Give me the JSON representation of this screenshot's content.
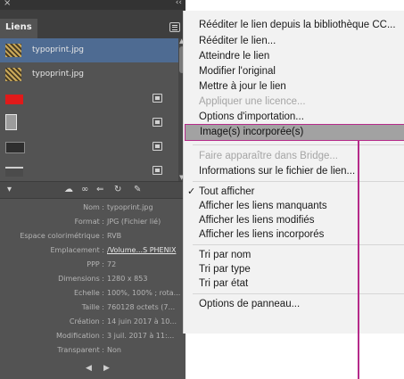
{
  "panel": {
    "close_glyph": "×",
    "collapse_glyph": "‹‹",
    "tab_label": "Liens",
    "links": [
      {
        "name": "typoprint.jpg",
        "thumb": "texture-thumbnail",
        "selected": true,
        "embedded": false
      },
      {
        "name": "typoprint.jpg",
        "thumb": "texture-thumbnail",
        "selected": false,
        "embedded": false
      },
      {
        "name": "",
        "thumb": "red-thumbnail",
        "selected": false,
        "embedded": true
      },
      {
        "name": "",
        "thumb": "portrait-thumbnail",
        "selected": false,
        "embedded": true
      },
      {
        "name": "",
        "thumb": "dark-thumbnail",
        "selected": false,
        "embedded": true
      },
      {
        "name": "",
        "thumb": "gray-thumbnail",
        "selected": false,
        "embedded": true
      }
    ],
    "toolbar_icons": [
      "disclosure-triangle-icon",
      "cloud-link-icon",
      "chain-link-icon",
      "relink-icon",
      "update-link-icon",
      "edit-original-icon"
    ],
    "info": [
      {
        "label": "Nom :",
        "value": "typoprint.jpg"
      },
      {
        "label": "Format :",
        "value": "JPG (Fichier lié)"
      },
      {
        "label": "Espace colorimétrique :",
        "value": "RVB"
      },
      {
        "label": "Emplacement :",
        "value": "/Volume...S PHENIX",
        "link": true
      },
      {
        "label": "PPP :",
        "value": "72"
      },
      {
        "label": "Dimensions :",
        "value": "1280 x 853"
      },
      {
        "label": "Echelle :",
        "value": "100%, 100% ; rota..."
      },
      {
        "label": "Taille :",
        "value": "760128 octets (7..."
      },
      {
        "label": "Création :",
        "value": "14 juin 2017 à 10..."
      },
      {
        "label": "Modification :",
        "value": "3 juil. 2017 à 11:..."
      },
      {
        "label": "Transparent :",
        "value": "Non"
      }
    ],
    "nav_prev": "◀",
    "nav_next": "▶"
  },
  "menu": {
    "group1": [
      {
        "label": "Rééditer le lien depuis la bibliothèque CC...",
        "disabled": false
      },
      {
        "label": "Rééditer le lien...",
        "disabled": false
      },
      {
        "label": "Atteindre le lien",
        "disabled": false
      },
      {
        "label": "Modifier l'original",
        "disabled": false
      },
      {
        "label": "Mettre à jour le lien",
        "disabled": false
      },
      {
        "label": "Appliquer une licence...",
        "disabled": true
      },
      {
        "label": "Options d'importation...",
        "disabled": false
      }
    ],
    "highlighted": {
      "label": "Image(s) incorporée(s)"
    },
    "group3": [
      {
        "label": "Faire apparaître dans Bridge...",
        "disabled": true
      },
      {
        "label": "Informations sur le fichier de lien...",
        "disabled": false
      }
    ],
    "group4": [
      {
        "label": "Tout afficher",
        "checked": true
      },
      {
        "label": "Afficher les liens manquants",
        "checked": false
      },
      {
        "label": "Afficher les liens modifiés",
        "checked": false
      },
      {
        "label": "Afficher les liens incorporés",
        "checked": false
      }
    ],
    "check_glyph": "✓",
    "group5": [
      {
        "label": "Tri par nom"
      },
      {
        "label": "Tri par type"
      },
      {
        "label": "Tri par état"
      }
    ],
    "group6": [
      {
        "label": "Options de panneau..."
      }
    ]
  },
  "colors": {
    "panel_bg": "#535353",
    "selection": "#4e6b92",
    "menu_bg": "#f2f2f2",
    "highlight_bg": "#a2a2a2",
    "callout": "#b52b8a"
  }
}
